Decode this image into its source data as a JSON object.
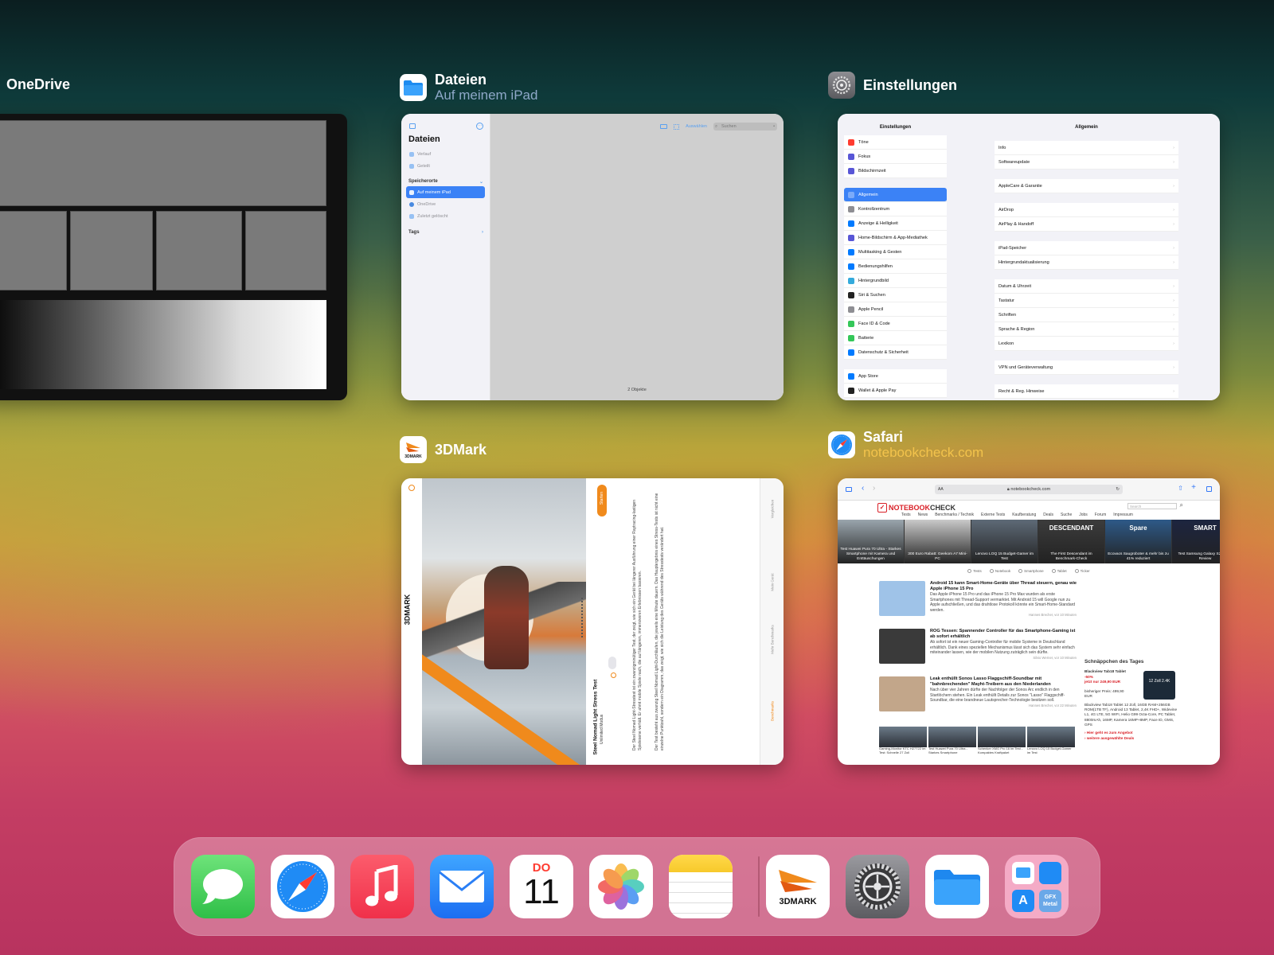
{
  "switcher": {
    "apps": [
      {
        "name": "OneDrive"
      },
      {
        "name": "Dateien",
        "subtitle": "Auf meinem iPad"
      },
      {
        "name": "Einstellungen"
      },
      {
        "name": "3DMark"
      },
      {
        "name": "Safari",
        "subtitle": "notebookcheck.com"
      }
    ]
  },
  "files": {
    "title": "Dateien",
    "recent": "Verlauf",
    "shared": "Geteilt",
    "locations_header": "Speicherorte",
    "locations": [
      "Auf meinem iPad",
      "OneDrive",
      "Zuletzt gelöscht"
    ],
    "tags": "Tags",
    "select": "Auswählen",
    "search_placeholder": "Suchen",
    "count": "2 Objekte"
  },
  "settings": {
    "sidebar_title": "Einstellungen",
    "main_title": "Allgemein",
    "sidebar_groups": [
      [
        "Töne",
        "Fokus",
        "Bildschirmzeit"
      ],
      [
        "Allgemein",
        "Kontrollzentrum",
        "Anzeige & Helligkeit",
        "Home-Bildschirm & App-Mediathek",
        "Multitasking & Gesten",
        "Bedienungshilfen",
        "Hintergrundbild",
        "Siri & Suchen",
        "Apple Pencil",
        "Face ID & Code",
        "Batterie",
        "Datenschutz & Sicherheit"
      ],
      [
        "App Store",
        "Wallet & Apple Pay"
      ]
    ],
    "sidebar_colors": [
      [
        "#ff3b30",
        "#5856d6",
        "#5856d6"
      ],
      [
        "#8e8e93",
        "#8e8e93",
        "#007aff",
        "#5856d6",
        "#007aff",
        "#007aff",
        "#34aadc",
        "#222222",
        "#8e8e93",
        "#34c759",
        "#34c759",
        "#007aff"
      ],
      [
        "#007aff",
        "#222222"
      ]
    ],
    "main_groups": [
      [
        "Info",
        "Softwareupdate"
      ],
      [
        "AppleCare & Garantie"
      ],
      [
        "AirDrop",
        "AirPlay & Handoff"
      ],
      [
        "iPad-Speicher",
        "Hintergrundaktualisierung"
      ],
      [
        "Datum & Uhrzeit",
        "Tastatur",
        "Schriften",
        "Sprache & Region",
        "Lexikon"
      ],
      [
        "VPN und Geräteverwaltung"
      ],
      [
        "Recht & Reg. Hinweise"
      ]
    ]
  },
  "mark": {
    "start_label": "Starten",
    "test_title": "Steel Nomad Light Stress Test",
    "mode": "Unlimited Modus",
    "desc": "Der Steel Nomad Light-Stresstest ist ein zwanzigminütiger Test, der zeigt, wie sich ein Gerät bei längerer Ausführung einer Raytracing-lastigen Spielesene verhält. Er ahmt mobile Spiele nach, die auf längeren, immersiveren Erlebnissen basieren.",
    "desc2": "Der Test besteht aus zwanzig Steel Nomad Light-Durchläufen, die jeweils eine Minute dauern. Das Hauptergebnis eines Stress-Tests ist nicht eine einzelne Punktzahl, sondern ein Diagramm, das zeigt, wie sich die Leistung des Geräts während des Stresstests verändert hat.",
    "brand": "3DMARK",
    "side_tabs": [
      "Vergleichen",
      "Mein Gerät",
      "Mehr Benchmarks",
      "Benchmarks"
    ]
  },
  "safari": {
    "url": "notebookcheck.com",
    "reader": "AA",
    "site_name_a": "NOTEBOOK",
    "site_name_b": "CHECK",
    "search_placeholder": "Search",
    "nav": [
      "Tests",
      "News",
      "Benchmarks / Technik",
      "Externe Tests",
      "Kaufberatung",
      "Deals",
      "Suche",
      "Jobs",
      "Forum",
      "Impressum"
    ],
    "thumbs": [
      "Test Huawei Pura 70 Ultra - Starkes Smartphone mit Kamera und Enttäuschungen",
      "300 Euro Rabatt: Geekom A7 Mini-PC",
      "Lenovo LOQ 15 Budget-Gamer im Test",
      "The First Descendant im Benchmark-Check",
      "Ecovacs Saugroboter & mehr bis zu 41% reduziert",
      "Test Samsung Galaxy S24 Ultra Review"
    ],
    "thumb_overlays": [
      "DESCENDANT",
      "Spare",
      "SMART"
    ],
    "filters": [
      "Tests",
      "Notebook",
      "Smartphone",
      "Tablet",
      "Ticker"
    ],
    "articles": [
      {
        "title": "Android 15 kann Smart-Home-Geräte über Thread steuern, genau wie Apple iPhone 15 Pro",
        "text": "Das Apple iPhone 15 Pro und das iPhone 15 Pro Max wurden als erste Smartphones mit Thread-Support vermarktet. Mit Android 15 will Google nun zu Apple aufschließen, und das drahtlose Protokoll könnte ein Smart-Home-Standard werden.",
        "meta": "Hannes Brecher, vor 10 Minuten"
      },
      {
        "title": "ROG Tessen: Spannender Controller für das Smartphone-Gaming ist ab sofort erhältlich",
        "text": "Ab sofort ist ein neuer Gaming-Controller für mobile Systeme in Deutschland erhältlich. Dank eines speziellen Mechanismus lässt sich das System sehr einfach miteinander lassen, wie der mobilen Nutzung zuträglich sein dürfte.",
        "meta": "Silvio Werner, vor 10 Minuten"
      },
      {
        "title": "Leak enthüllt Sonos Lasso Flaggschiff-Soundbar mit \"bahnbrechenden\" Mayht-Treibern aus den Niederlanden",
        "text": "Nach über vier Jahren dürfte der Nachfolger der Sonos Arc endlich in den Startlöchern stehen. Ein Leak enthüllt Details zur Sonos \"Lasso\" Flaggschiff-Soundbar, die eine brandneue Lautsprecher-Technologie besitzen soll.",
        "meta": "Hannes Brecher, vor 22 Minuten"
      }
    ],
    "deals_title": "Schnäppchen des Tages",
    "deal_name": "Blackview Tab18 Tablet",
    "deal_discount": "-50%",
    "deal_price": "jetzt nur 249,90 EUR",
    "deal_old": "bisheriger Preis: 499,90 EUR",
    "deal_desc": "Blackview Tab18 Tablet 12 Zoll, 16GB RAM+256GB ROM(1TB TF), Android 13 Tablet, 2,4K FHD+, Widevine L1, 4G LTE, 5G WIFI, Helio G99 Octa-Core, PC Tablet, 8800mAh, 16MP, Kamera 16MP+8MP, Face ID, GMS, GPS",
    "deal_badge": "12 Zoll 2.4K",
    "deal_link1": "› Hier geht es zum Angebot",
    "deal_link2": "› weitere ausgewählte Deals",
    "strip": [
      "Gaming-Monitor KTC H27T22 im Test: Schnelle 27 Zoll",
      "Test Huawei Pura 70 Ultra - Starkes Smartphone",
      "Schenker XMG Pro 16 im Test - Kompaktes Kraftpaket",
      "Lenovo LOQ 15 Budget-Gamer im Test"
    ]
  },
  "dock": {
    "apps": [
      "Nachrichten",
      "Safari",
      "Musik",
      "Mail",
      "Kalender",
      "Fotos",
      "Notizen",
      "3DMark",
      "Einstellungen",
      "Dateien",
      "Mediathek"
    ],
    "calendar_day": "DO",
    "calendar_date": "11",
    "mark_label": "3DMARK",
    "gfx_label": "GFX Metal"
  }
}
